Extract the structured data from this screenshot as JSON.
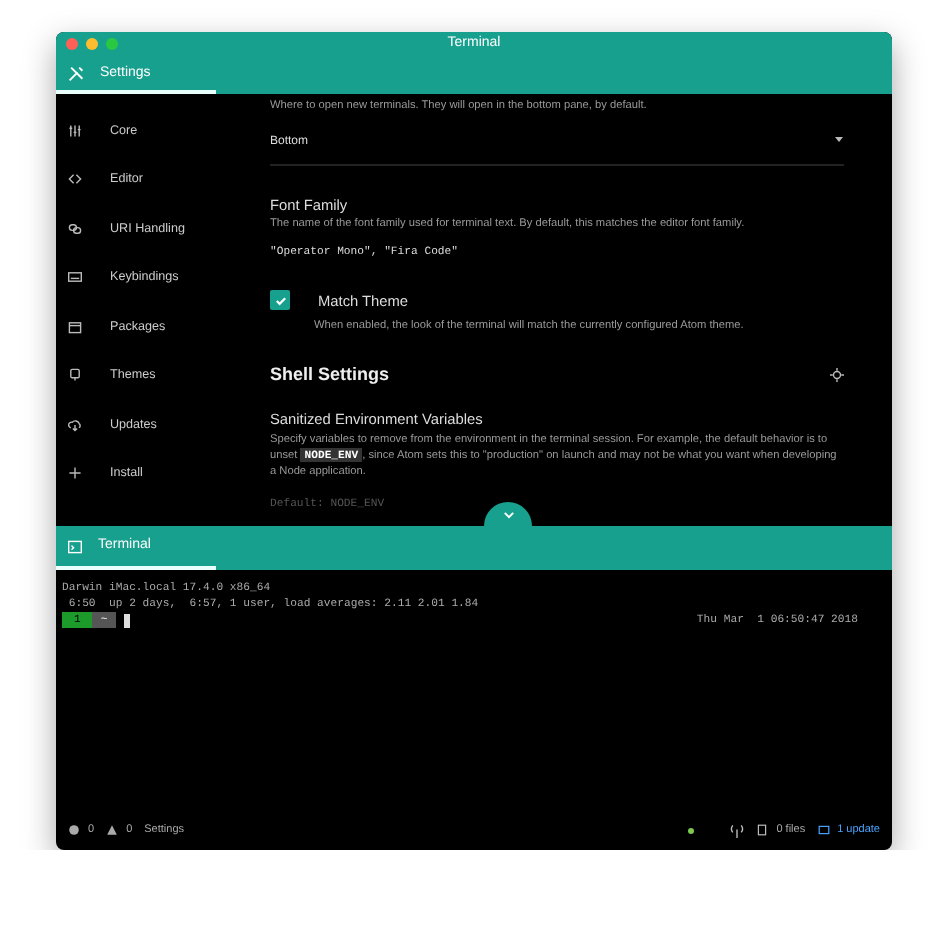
{
  "window": {
    "title": "Terminal"
  },
  "top_tab": {
    "label": "Settings",
    "selected": true
  },
  "sidebar": {
    "items": [
      {
        "label": "Core",
        "selected": false
      },
      {
        "label": "Editor",
        "selected": false
      },
      {
        "label": "URI Handling",
        "selected": false
      },
      {
        "label": "Keybindings",
        "selected": false
      },
      {
        "label": "Packages",
        "selected": false
      },
      {
        "label": "Themes",
        "selected": false
      },
      {
        "label": "Updates",
        "selected": false
      },
      {
        "label": "Install",
        "selected": false
      }
    ]
  },
  "settings": [
    {
      "kind": "select",
      "description": "Where to open new terminals. They will open in the bottom pane, by default.",
      "value": "Bottom"
    },
    {
      "kind": "text",
      "title": "Font Family",
      "description": "The name of the font family used for terminal text. By default, this matches the editor font family.",
      "value": "\"Operator Mono\", \"Fira Code\""
    },
    {
      "kind": "checkbox",
      "title": "Match Theme",
      "checked": true,
      "description": "When enabled, the look of the terminal will match the currently configured Atom theme."
    },
    {
      "kind": "section",
      "title": "Shell Settings"
    },
    {
      "kind": "list",
      "title": "Sanitized Environment Variables",
      "description": [
        {
          "kind": "text",
          "text": "Specify variables to remove from the environment in the terminal session. For example, the default behavior is to unset "
        },
        {
          "kind": "code",
          "text": "NODE_ENV"
        },
        {
          "kind": "text",
          "text": ", since Atom sets this to \"production\" on launch and may not be what you want when developing a Node application."
        }
      ],
      "value": "Default: NODE_ENV"
    }
  ],
  "bottom_tab": {
    "label": "Terminal",
    "selected": true
  },
  "terminal": {
    "lines": [
      "Darwin iMac.local 17.4.0 x86_64",
      " 6:50  up 2 days,  6:57, 1 user, load averages: 2.11 2.01 1.84"
    ],
    "prompt": {
      "segment_1": "1",
      "segment_2": "~"
    },
    "right_text": "Thu Mar  1 06:50:47 2018"
  },
  "status_bar": {
    "errors": "0",
    "warnings": "0",
    "settings": "Settings",
    "files": "0 files",
    "updates": "1 update"
  }
}
